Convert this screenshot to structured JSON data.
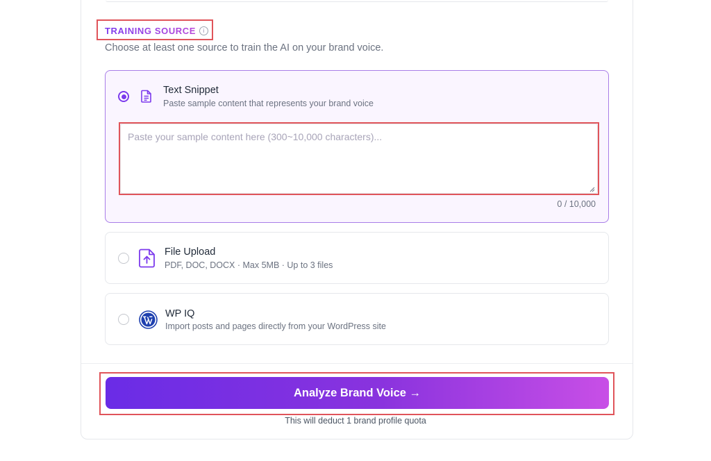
{
  "section": {
    "title": "TRAINING SOURCE",
    "info_glyph": "i",
    "subtitle": "Choose at least one source to train the AI on your brand voice."
  },
  "options": [
    {
      "id": "text-snippet",
      "title": "Text Snippet",
      "description": "Paste sample content that represents your brand voice",
      "icon": "document-icon",
      "selected": true
    },
    {
      "id": "file-upload",
      "title": "File Upload",
      "description": "PDF, DOC, DOCX · Max 5MB · Up to 3 files",
      "icon": "file-upload-icon",
      "selected": false
    },
    {
      "id": "wp-iq",
      "title": "WP IQ",
      "description": "Import posts and pages directly from your WordPress site",
      "icon": "wordpress-icon",
      "selected": false
    }
  ],
  "snippet": {
    "placeholder": "Paste your sample content here (300~10,000 characters)...",
    "value": "",
    "counter": "0 / 10,000"
  },
  "cta": {
    "label": "Analyze Brand Voice →",
    "note": "This will deduct 1 brand profile quota"
  },
  "colors": {
    "accent": "#7c3aed",
    "gradient_end": "#c84fe6",
    "highlight": "#e0545a"
  }
}
